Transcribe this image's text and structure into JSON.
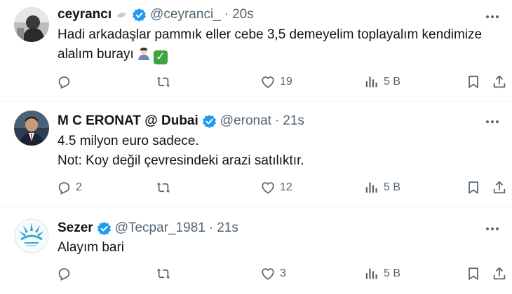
{
  "tweets": [
    {
      "name": "ceyrancı",
      "handle": "@ceyranci_",
      "dot": "·",
      "time": "20s",
      "text_line1": "Hadi arkadaşlar pammık eller cebe 3,5 demeyelim toplayalım kendimize",
      "text_line2": "alalım burayı",
      "replies": "",
      "retweets": "",
      "likes": "19",
      "views": "5 B"
    },
    {
      "name": "M C ERONAT @ Dubai",
      "handle": "@eronat",
      "dot": "·",
      "time": "21s",
      "text_line1": "4.5 milyon euro sadece.",
      "text_line2": "Not: Koy değil çevresindeki arazi satılıktır.",
      "replies": "2",
      "retweets": "",
      "likes": "12",
      "views": "5 B"
    },
    {
      "name": "Sezer",
      "handle": "@Tecpar_1981",
      "dot": "·",
      "time": "21s",
      "text_line1": "Alayım bari",
      "replies": "",
      "retweets": "",
      "likes": "3",
      "views": "5 B"
    }
  ],
  "colors": {
    "verified": "#1d9bf0",
    "muted": "#536471",
    "divider": "#eff3f4"
  },
  "icons": [
    "reply-icon",
    "retweet-icon",
    "like-icon",
    "views-icon",
    "bookmark-icon",
    "share-icon",
    "more-icon",
    "verified-badge-icon"
  ]
}
